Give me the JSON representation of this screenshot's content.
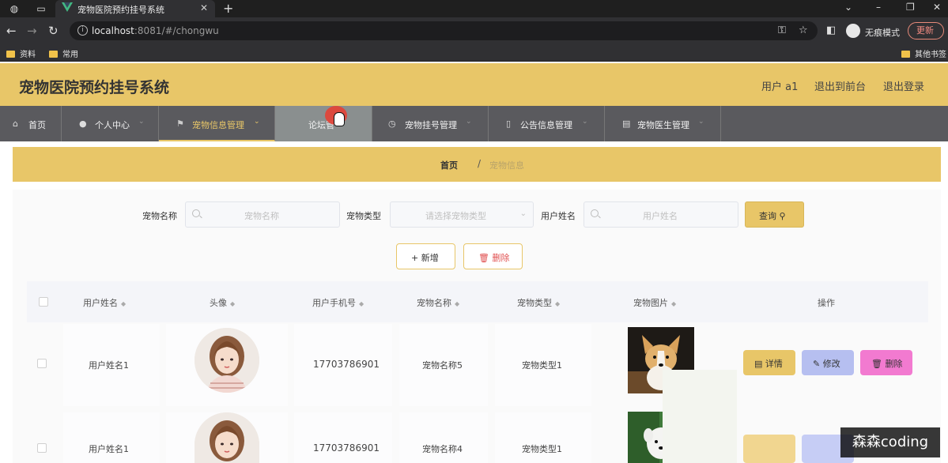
{
  "browser": {
    "tab_title": "宠物医院预约挂号系统",
    "url_host": "localhost",
    "url_rest": ":8081/#/chongwu",
    "incognito_label": "无痕模式",
    "update_label": "更新",
    "bookmarks": [
      "资料",
      "常用",
      "其他书签"
    ]
  },
  "app": {
    "title": "宠物医院预约挂号系统",
    "user_label": "用户 a1",
    "to_frontend": "退出到前台",
    "logout": "退出登录"
  },
  "nav": {
    "items": [
      {
        "label": "首页",
        "icon": "home-icon"
      },
      {
        "label": "个人中心",
        "icon": "user-icon"
      },
      {
        "label": "宠物信息管理",
        "icon": "flag-icon"
      },
      {
        "label": "论坛管",
        "icon": ""
      },
      {
        "label": "宠物挂号管理",
        "icon": "clock-icon"
      },
      {
        "label": "公告信息管理",
        "icon": "mic-icon"
      },
      {
        "label": "宠物医生管理",
        "icon": "doc-icon"
      }
    ]
  },
  "breadcrumb": {
    "home": "首页",
    "sep": "/",
    "current": "宠物信息"
  },
  "search": {
    "pet_name_label": "宠物名称",
    "pet_name_placeholder": "宠物名称",
    "pet_type_label": "宠物类型",
    "pet_type_placeholder": "请选择宠物类型",
    "user_name_label": "用户姓名",
    "user_name_placeholder": "用户姓名",
    "query_label": "查询"
  },
  "actions": {
    "add_label": "新增",
    "delete_label": "删除"
  },
  "table": {
    "headers": [
      "用户姓名",
      "头像",
      "用户手机号",
      "宠物名称",
      "宠物类型",
      "宠物图片",
      "操作"
    ],
    "rows": [
      {
        "user_name": "用户姓名1",
        "phone": "17703786901",
        "pet_name": "宠物名称5",
        "pet_type": "宠物类型1"
      },
      {
        "user_name": "用户姓名1",
        "phone": "17703786901",
        "pet_name": "宠物名称4",
        "pet_type": "宠物类型1"
      }
    ],
    "row_buttons": {
      "detail": "详情",
      "edit": "修改",
      "delete": "删除"
    }
  },
  "watermark": "森森coding",
  "colors": {
    "accent": "#e8c668",
    "nav_bg": "#5a5a5e",
    "edit": "#b6bff0",
    "delete": "#f27ad0"
  }
}
